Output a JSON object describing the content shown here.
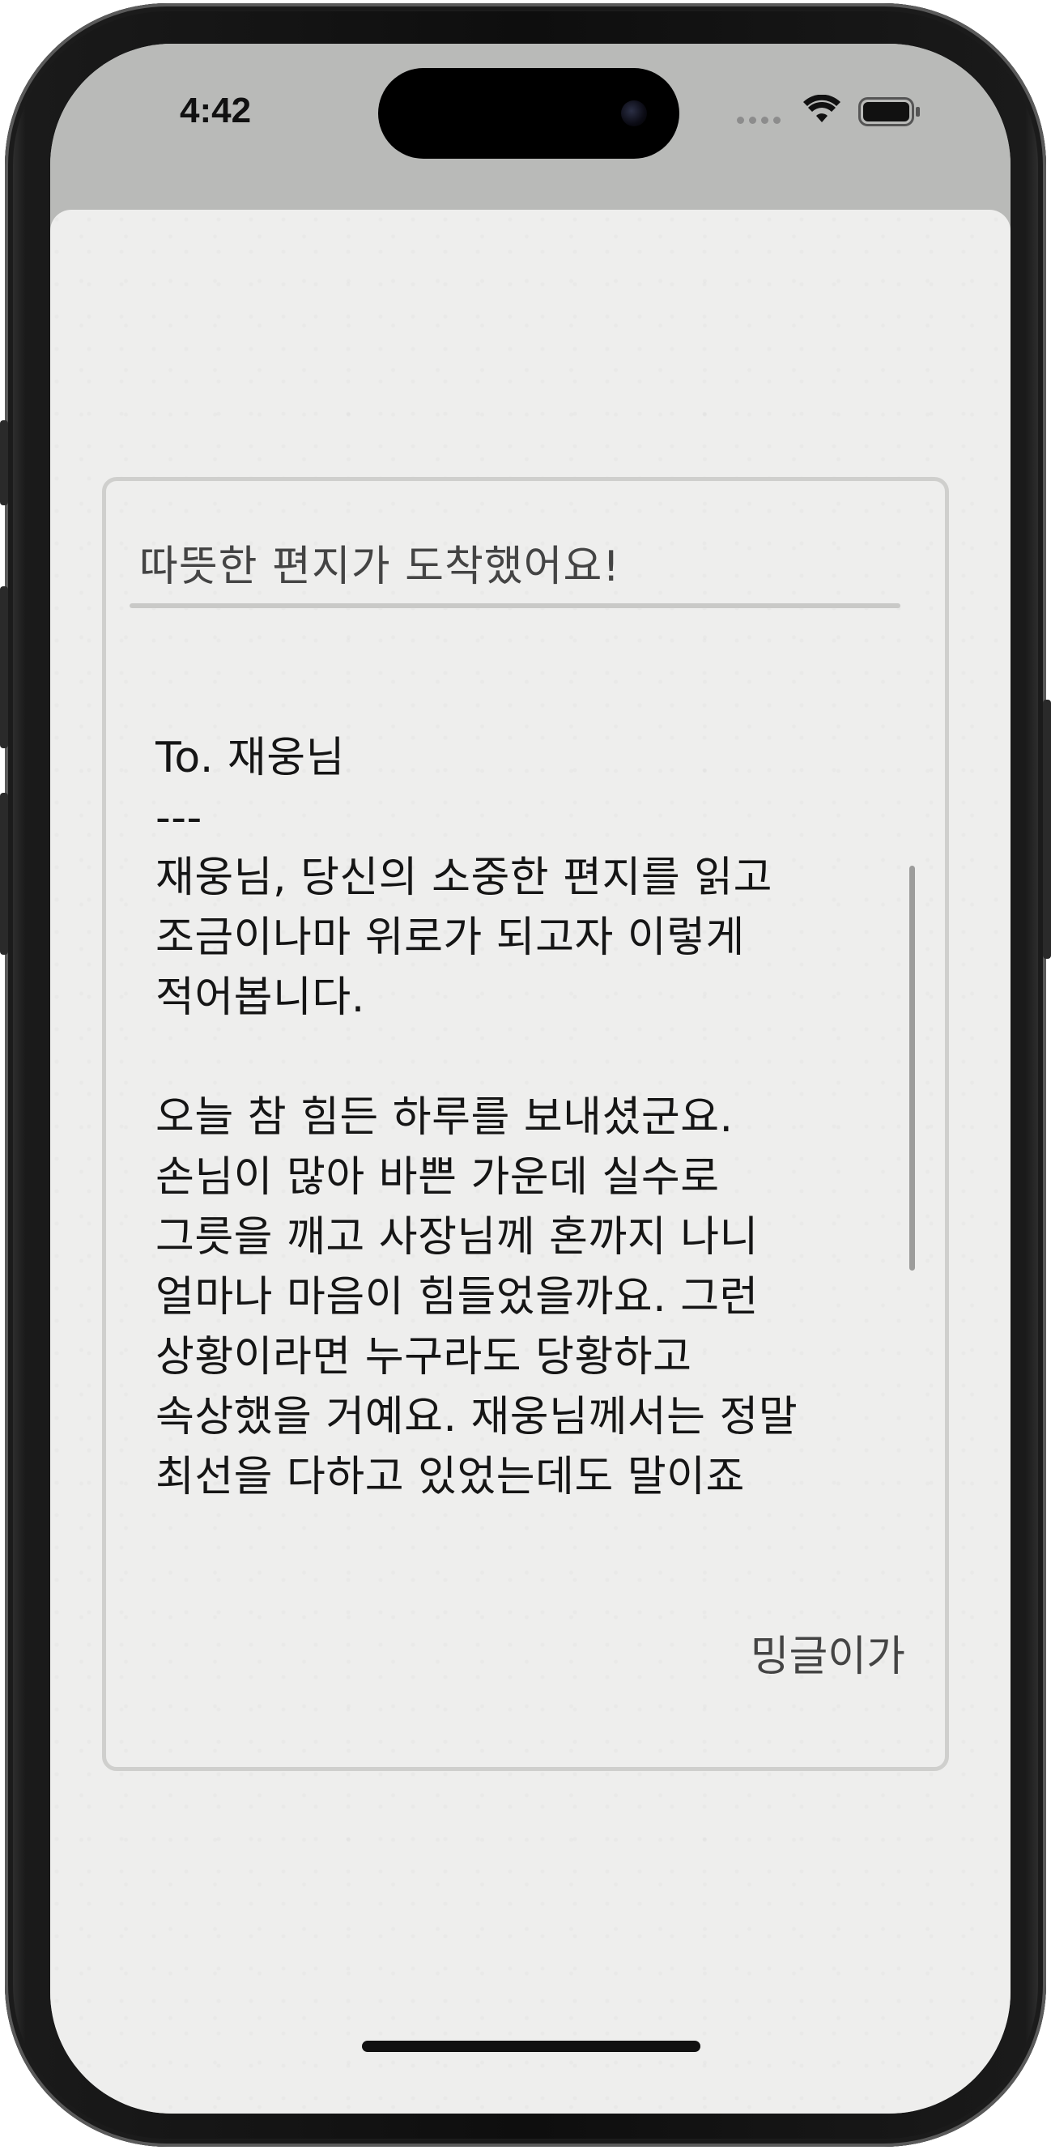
{
  "status_bar": {
    "time": "4:42",
    "icons": [
      "signal-dots-icon",
      "wifi-icon",
      "battery-icon"
    ]
  },
  "letter": {
    "header": "따뜻한 편지가 도착했어요!",
    "body": "To. 재웅님\n---\n재웅님, 당신의 소중한 편지를 읽고\n조금이나마 위로가 되고자 이렇게\n적어봅니다.\n\n오늘 참 힘든 하루를 보내셨군요.\n손님이 많아 바쁜 가운데 실수로\n그릇을 깨고 사장님께 혼까지 나니\n얼마나 마음이 힘들었을까요. 그런\n상황이라면 누구라도 당황하고\n속상했을 거예요. 재웅님께서는 정말\n최선을 다하고 있었는데도 말이죠",
    "signature": "밍글이가"
  },
  "colors": {
    "background": "#eeeeed",
    "status_bar": "#b9bab8",
    "frame": "#cfcfcd",
    "text": "#151515"
  }
}
